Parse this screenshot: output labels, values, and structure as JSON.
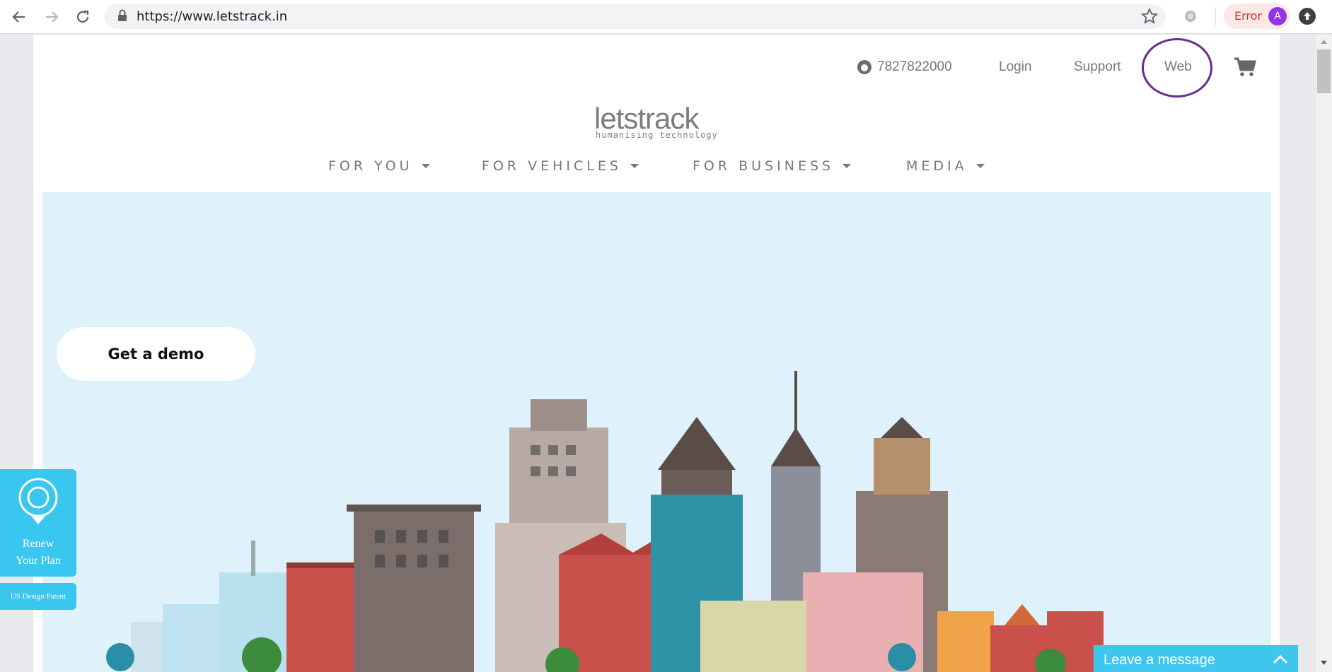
{
  "browser": {
    "url": "https://www.letstrack.in",
    "profile_status": "Error",
    "profile_initial": "A"
  },
  "topnav": {
    "phone": "7827822000",
    "login": "Login",
    "support": "Support",
    "web": "Web"
  },
  "logo": {
    "name": "letstrack",
    "tagline": "humanising technology"
  },
  "menu": [
    {
      "label": "FOR YOU"
    },
    {
      "label": "FOR VEHICLES"
    },
    {
      "label": "FOR BUSINESS"
    },
    {
      "label": "MEDIA"
    }
  ],
  "hero": {
    "cta": "Get a demo"
  },
  "widgets": {
    "renew_line1": "Renew",
    "renew_line2": "Your Plan",
    "patent": "US Design Patent",
    "chat": "Leave a message"
  },
  "colors": {
    "accent": "#39c6ef",
    "hero_bg": "#dff1fb",
    "highlight_circle": "#6a2c91"
  }
}
